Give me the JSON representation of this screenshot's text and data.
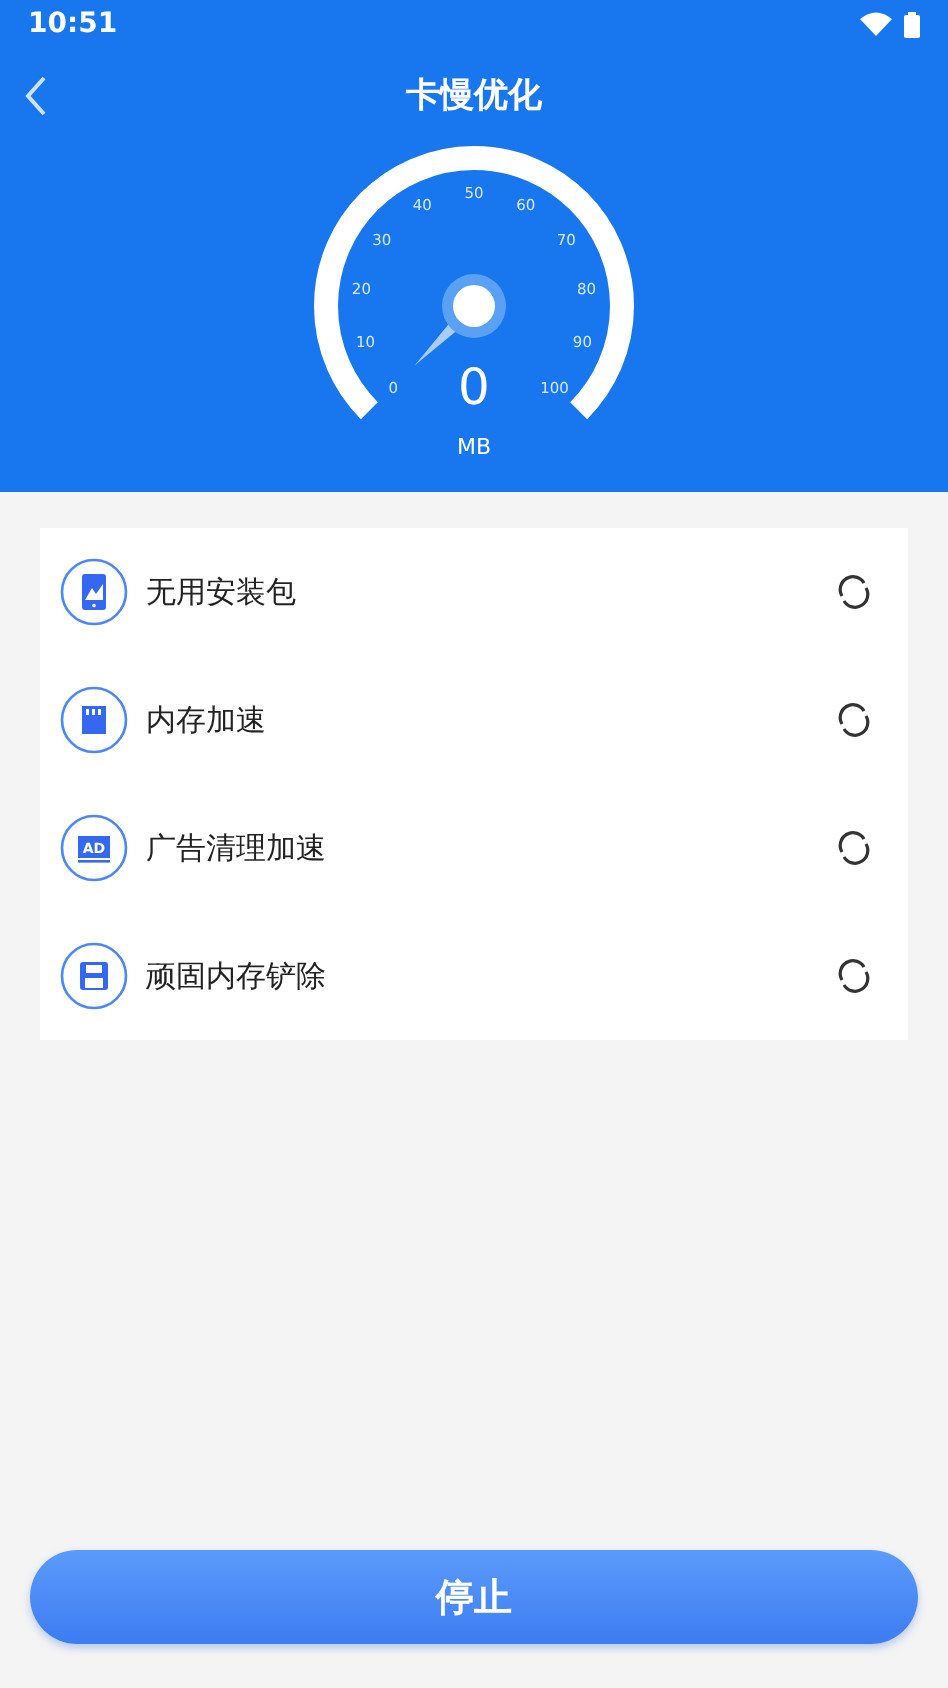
{
  "status_bar": {
    "time": "10:51"
  },
  "header": {
    "title": "卡慢优化"
  },
  "gauge": {
    "ticks": [
      "0",
      "10",
      "20",
      "30",
      "40",
      "50",
      "60",
      "70",
      "80",
      "90",
      "100"
    ],
    "reading": "0",
    "unit": "MB"
  },
  "items": [
    {
      "label": "无用安装包",
      "kind": "phone"
    },
    {
      "label": "内存加速",
      "kind": "sdcard"
    },
    {
      "label": "广告清理加速",
      "kind": "ad",
      "badge": "AD"
    },
    {
      "label": "顽固内存铲除",
      "kind": "floppy"
    }
  ],
  "button": {
    "label": "停止"
  }
}
